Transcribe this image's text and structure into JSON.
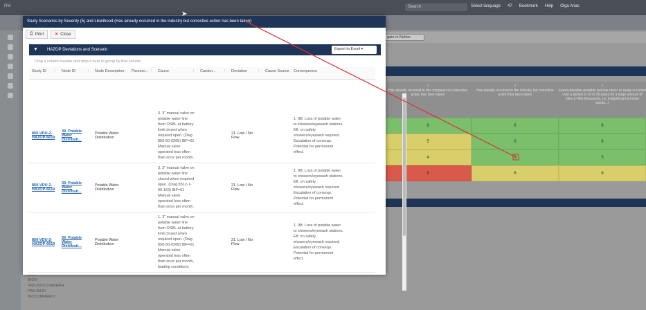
{
  "topbar": {
    "logo": "RM",
    "search": "Search",
    "items": [
      "Select language",
      "47",
      "Bookmark",
      "Help",
      "Olga Arias"
    ]
  },
  "bg": {
    "select_value": "gate in Notice",
    "matrix_headers": [
      "Has already occurred in the company but corrective action has been taken",
      "Has already occurred in the industry but corrective action has been taken",
      "Event plausible possible but has never or rarely occurred over a period of 10 to 50 years for a large amount of sites (> few thousands, i.e. Insignificant process plants...)"
    ],
    "matrix_nums": [
      "7",
      "7",
      "7"
    ],
    "matrix_cells": [
      {
        "v": "6",
        "c": "#7bbf6a"
      },
      {
        "v": "6",
        "c": "#7bbf6a"
      },
      {
        "v": "6",
        "c": "#7bbf6a"
      },
      {
        "v": "5",
        "c": "#d9cf6a"
      },
      {
        "v": "6",
        "c": "#7bbf6a"
      },
      {
        "v": "6",
        "c": "#7bbf6a"
      },
      {
        "v": "4",
        "c": "#d9cf6a"
      },
      {
        "v": "3",
        "c": "#7bbf6a"
      },
      {
        "v": "5",
        "c": "#7bbf6a"
      },
      {
        "v": "6",
        "c": "#d95a4a"
      },
      {
        "v": "6",
        "c": "#d9cf6a"
      },
      {
        "v": "6",
        "c": "#d9cf6a"
      }
    ],
    "tree": [
      "VRG",
      "BIOH",
      "VRG-BIOCOMMERH",
      "PAB-BIOH",
      "BIOCOMMERCI"
    ]
  },
  "modal": {
    "title": "Study Scenarios by Severity (5) and Likelihood (Has already occurred in the industry but corrective action has been taken)",
    "print_label": "Print",
    "close_label": "Close",
    "panel_title": "HAZOP Deviations and Scenario",
    "export_label": "Export to Excel",
    "group_hint": "Drag a column header and drop it here to group by that column",
    "columns": [
      "Study ID",
      "Node ID",
      "Node Description",
      "Parame...",
      "Cause",
      "Cardon...",
      "Deviation",
      "Cause Source",
      "Consequence"
    ],
    "rows": [
      {
        "study_id": "850-VDU-2-HAZOP-6619",
        "node_id": "39. Potable Water Distributi...",
        "node_desc": "Potable Water Distribution",
        "cause": "3. 3\" manual valve on potable water line from OSBL at battery limit closed when required open. (Dwg 850-50-0268) IBF=01 Manual valve operated less often than once per month.",
        "deviation": "21. Low / No Flow",
        "consequence": "1. 9B: Loss of potable water to showers/eyewash stations. Eff. on safety showers/eyewash required. Escalation of consequ. Potential for permanent effect."
      },
      {
        "study_id": "850-VDU-2-HAZOP-6619",
        "node_id": "39. Potable Water Distributi...",
        "node_desc": "Potable Water Distribution",
        "cause": "3. 3\" manual valve on potable water line closed when required open. (Dwg 8512-1-00-153) IBF=01 Manual valve operated less often than once per month.",
        "deviation": "21. Low / No Flow",
        "consequence": "1. 9B: Loss of potable water to showers/eyewash stations. Eff. on safety showers/eyewash required. Escalation of consequ. Potential for permanent effect."
      },
      {
        "study_id": "850-VDU-2-HAZOP-6619",
        "node_id": "39. Potable Water Distributi...",
        "node_desc": "Potable Water Distribution",
        "cause": "1. 3\" manual valve on potable water line from OSBL at battery limit closed when required open. (Dwg 850-50-0268) IBF=01 Manual valve operated less often than once per month, leading conditions.",
        "deviation": "21. Low / No Flow",
        "consequence": "1. 9B: Loss of potable water to showers/eyewash stations. Eff. on safety showers/eyewash required. Escalation of consequ. Potential for permanent effect."
      }
    ]
  }
}
